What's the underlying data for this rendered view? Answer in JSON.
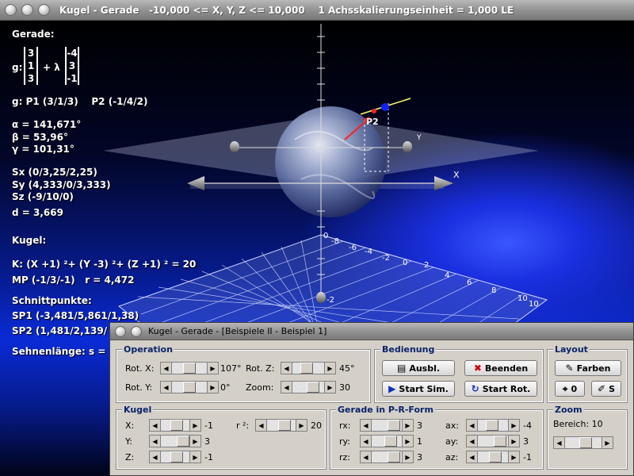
{
  "main_title": "Kugel - Gerade   -10,000 <= X, Y, Z <= 10,000    1 Achsskalierungseinheit = 1,000 LE",
  "info": {
    "gerade_heading": "Gerade:",
    "g_label": "g:",
    "vec_a": [
      "3",
      "1",
      "3"
    ],
    "plus_lambda": "+ λ",
    "vec_b": [
      "-4",
      "3",
      "-1"
    ],
    "points": "g: P1 (3/1/3)    P2 (-1/4/2)",
    "alpha": "α = 141,671°",
    "beta": "β = 53,96°",
    "gamma": "γ = 101,31°",
    "sx": "Sx (0/3,25/2,25)",
    "sy": "Sy (4,333/0/3,333)",
    "sz": "Sz (-9/10/0)",
    "d": "d = 3,669",
    "kugel_heading": "Kugel:",
    "k_eq": "K: (X +1) ²+ (Y -3) ²+ (Z +1) ² = 20",
    "mp": "MP (-1/3/-1)   r = 4,472",
    "schnitt_heading": "Schnittpunkte:",
    "sp1": "SP1 (-3,481/5,861/1,38)",
    "sp2": "SP2 (1,481/2,139/",
    "sehnen": "Sehnenlänge: s ="
  },
  "scene": {
    "axis_x": "X",
    "axis_y": "Y",
    "axis_p2": "P2",
    "grid_ticks_left": [
      "-8",
      "-6",
      "-4",
      "-2",
      "0"
    ],
    "grid_ticks_right": [
      "2",
      "4",
      "6",
      "8",
      "10"
    ],
    "tick_z_top": "0",
    "tick_z_bottom": "-2",
    "tick_10_a": "10",
    "tick_10_b": "10"
  },
  "ctrl": {
    "title": "Kugel - Gerade - [Beispiele II - Beispiel 1]",
    "operation": {
      "title": "Operation",
      "rotx_label": "Rot. X:",
      "rotx_val": "107°",
      "rotz_label": "Rot. Z:",
      "rotz_val": "45°",
      "roty_label": "Rot. Y:",
      "roty_val": "0°",
      "zoom_label": "Zoom:",
      "zoom_val": "30"
    },
    "bedienung": {
      "title": "Bedienung",
      "ausbl": "Ausbl.",
      "beenden": "Beenden",
      "start_sim": "Start Sim.",
      "start_rot": "Start Rot."
    },
    "layout": {
      "title": "Layout",
      "farben": "Farben",
      "o_btn": "0",
      "s_btn": "S"
    },
    "kugel": {
      "title": "Kugel",
      "x_label": "X:",
      "x_val": "-1",
      "y_label": "Y:",
      "y_val": "3",
      "z_label": "Z:",
      "z_val": "-1",
      "r2_label": "r ²:",
      "r2_val": "20"
    },
    "gerade": {
      "title": "Gerade in P-R-Form",
      "rx_label": "rx:",
      "rx_val": "3",
      "ry_label": "ry:",
      "ry_val": "1",
      "rz_label": "rz:",
      "rz_val": "3",
      "ax_label": "ax:",
      "ax_val": "-4",
      "ay_label": "ay:",
      "ay_val": "3",
      "az_label": "az:",
      "az_val": "-1"
    },
    "zoom": {
      "title": "Zoom",
      "bereich": "Bereich:  10"
    }
  },
  "colors": {
    "group_title": "#0a246a",
    "beenden_x": "#cc0000",
    "sim_blue": "#1030c0"
  }
}
